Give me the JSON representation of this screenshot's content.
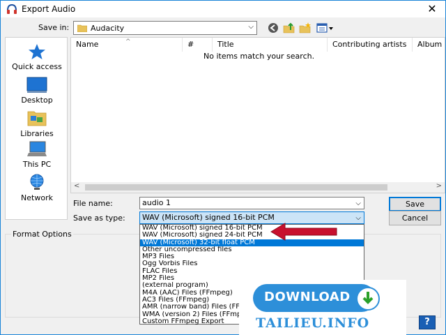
{
  "window": {
    "title": "Export Audio",
    "close": "✕"
  },
  "save_in": {
    "label": "Save in:",
    "value": "Audacity"
  },
  "toolbar": {
    "back_icon": "back-icon",
    "up_icon": "up-folder-icon",
    "new_folder_icon": "new-folder-icon",
    "view_icon": "view-menu-icon"
  },
  "places": [
    {
      "label": "Quick access",
      "icon": "star-icon"
    },
    {
      "label": "Desktop",
      "icon": "desktop-icon"
    },
    {
      "label": "Libraries",
      "icon": "libraries-icon"
    },
    {
      "label": "This PC",
      "icon": "computer-icon"
    },
    {
      "label": "Network",
      "icon": "network-icon"
    }
  ],
  "file_list": {
    "columns": [
      "Name",
      "#",
      "Title",
      "Contributing artists",
      "Album"
    ],
    "empty_message": "No items match your search."
  },
  "file_name": {
    "label": "File name:",
    "value": "audio 1"
  },
  "save_as_type": {
    "label": "Save as type:",
    "value": "WAV (Microsoft) signed 16-bit PCM",
    "options": [
      "WAV (Microsoft) signed 16-bit PCM",
      "WAV (Microsoft) signed 24-bit PCM",
      "WAV (Microsoft) 32-bit float PCM",
      "Other uncompressed files",
      "MP3 Files",
      "Ogg Vorbis Files",
      "FLAC Files",
      "MP2 Files",
      "(external program)",
      "M4A (AAC) Files (FFmpeg)",
      "AC3 Files (FFmpeg)",
      "AMR (narrow band) Files (FFm",
      "WMA (version 2) Files (FFmpeg",
      "Custom FFmpeg Export"
    ],
    "selected_index": 2
  },
  "buttons": {
    "save": "Save",
    "cancel": "Cancel",
    "help": "?"
  },
  "format_options": {
    "title": "Format Options"
  },
  "watermark": {
    "download": "DOWNLOAD",
    "site": "TAILIEU.INFO"
  },
  "colors": {
    "accent": "#0078d7",
    "arrow": "#c8102e",
    "watermark": "#2d8fd9"
  }
}
